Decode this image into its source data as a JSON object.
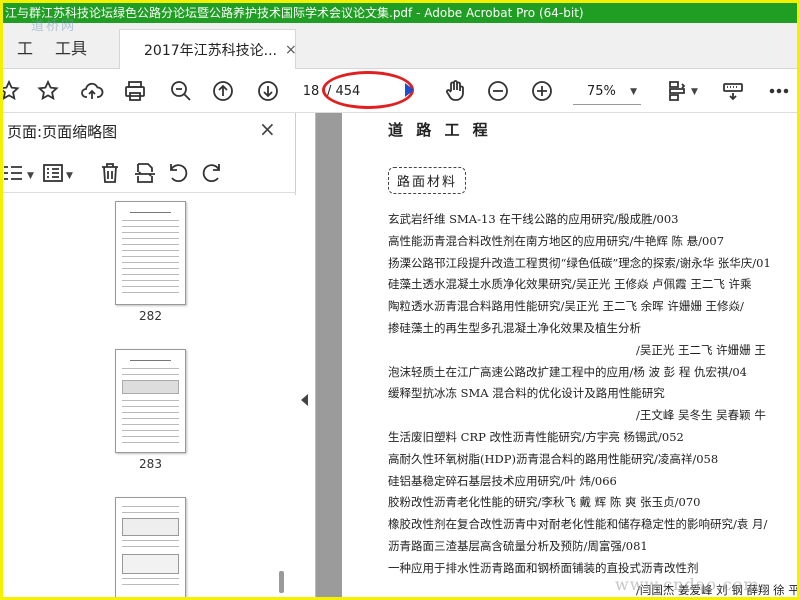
{
  "window": {
    "title": "江与群江苏科技论坛绿色公路分论坛暨公路养护技术国际学术会议论文集.pdf - Adobe Acrobat Pro (64-bit)"
  },
  "tabs": {
    "home": "工",
    "tools": "工具",
    "document": "2017年江苏科技论...",
    "close": "×"
  },
  "watermark": {
    "top_left": "道桥网",
    "bottom_right": "www.cndao.com"
  },
  "toolbar": {
    "page_current": "18",
    "page_total": "/ 454",
    "zoom": "75%",
    "icons": [
      "star-icon",
      "upload-icon",
      "print-icon",
      "zoom-search-icon",
      "page-up-icon",
      "page-down-icon",
      "hand-icon",
      "zoom-out-icon",
      "zoom-in-icon",
      "page-layout-icon",
      "keyboard-icon",
      "more-icon"
    ]
  },
  "sidebar": {
    "title": "页面缩略图",
    "title_prefix": "页面:",
    "close": "×",
    "thumbnails": [
      {
        "label": "282"
      },
      {
        "label": "283"
      },
      {
        "label": ""
      }
    ]
  },
  "document": {
    "heading": "道 路 工 程",
    "section": "路面材料",
    "lines": [
      {
        "text": "玄武岩纤维 SMA-13 在干线公路的应用研究/殷成胜/003",
        "indent": false
      },
      {
        "text": "高性能沥青混合料改性剂在南方地区的应用研究/牛艳辉 陈 悬/007",
        "indent": false
      },
      {
        "text": "扬溧公路邗江段提升改造工程贯彻“绿色低碳”理念的探索/谢永华 张华庆/01",
        "indent": false
      },
      {
        "text": "硅藻土透水混凝土水质净化效果研究/吴正光 王修焱 卢佩霞 王二飞 许乘",
        "indent": false
      },
      {
        "text": "陶粒透水沥青混合料路用性能研究/吴正光 王二飞 余晖 许姗姗 王修焱/",
        "indent": false
      },
      {
        "text": "掺硅藻土的再生型多孔混凝土净化效果及植生分析",
        "indent": false
      },
      {
        "text": "/吴正光 王二飞 许姗姗 王",
        "indent": true
      },
      {
        "text": "泡沫轻质土在江广高速公路改扩建工程中的应用/杨 波 彭 程 仇宏祺/04",
        "indent": false
      },
      {
        "text": "缓释型抗冰冻 SMA 混合料的优化设计及路用性能研究",
        "indent": false
      },
      {
        "text": "/王文峰 吴冬生 吴春颖 牛",
        "indent": true
      },
      {
        "text": "生活废旧塑料 CRP 改性沥青性能研究/方宇亮 杨锡武/052",
        "indent": false
      },
      {
        "text": "高耐久性环氧树脂(HDP)沥青混合料的路用性能研究/凌高祥/058",
        "indent": false
      },
      {
        "text": "硅铝基稳定碎石基层技术应用研究/叶 炜/066",
        "indent": false
      },
      {
        "text": "胶粉改性沥青老化性能的研究/李秋飞 戴 辉 陈 爽 张玉贞/070",
        "indent": false
      },
      {
        "text": "橡胶改性剂在复合改性沥青中对耐老化性能和储存稳定性的影响研究/袁 月/",
        "indent": false
      },
      {
        "text": "沥青路面三渣基层高含硫量分析及预防/周富强/081",
        "indent": false
      },
      {
        "text": "一种应用于排水性沥青路面和钢桥面铺装的直投式沥青改性剂",
        "indent": false
      },
      {
        "text": "/闫国杰 姜爱峰 刘 钢 薛翔 徐 平 焦 李",
        "indent": true
      }
    ]
  }
}
